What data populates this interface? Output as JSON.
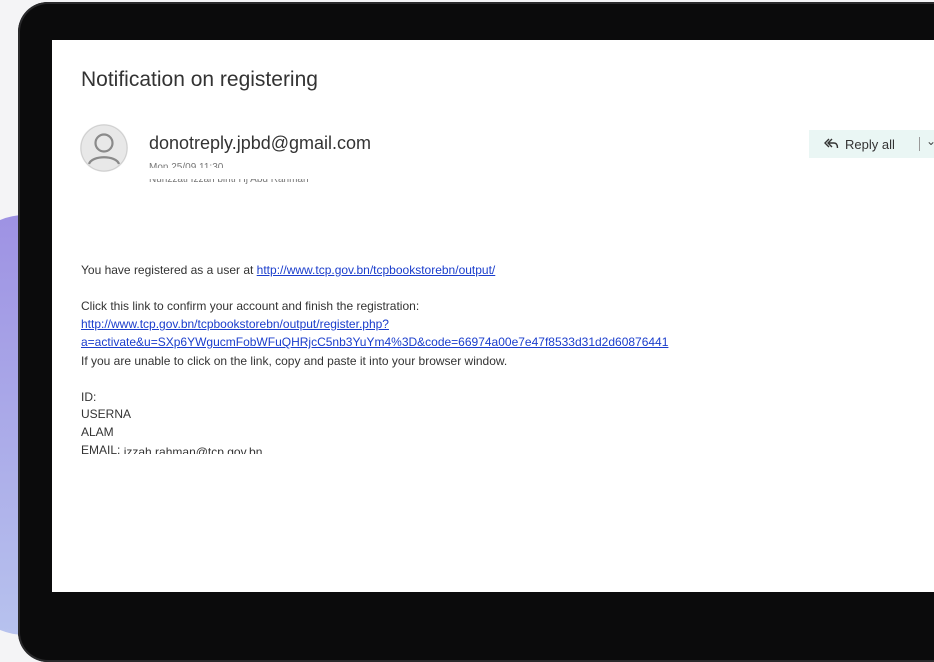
{
  "email": {
    "subject": "Notification on registering",
    "sender": "donotreply.jpbd@gmail.com",
    "date": "Mon 25/09 11:30",
    "to": "Nurizzati Izzah binti Hj Abd Rahman",
    "reply_all_label": "Reply all",
    "reply_menu_icon": "⌄"
  },
  "body": {
    "line1_prefix": "You have registered as a user at ",
    "line1_link": "http://www.tcp.gov.bn/tcpbookstorebn/output/",
    "confirm_text": "Click this link to confirm your account and finish the registration:",
    "confirm_link_1": "http://www.tcp.gov.bn/tcpbookstorebn/output/register.php?",
    "confirm_link_2": "a=activate&u=SXp6YWgucmFobWFuQHRjcC5nb3YuYm4%3D&code=66974a00e7e47f8533d31d2d60876441",
    "unable_text": "If you are unable to click on the link, copy and paste it into your browser window.",
    "id_label": "ID:",
    "username_label": "USERNA",
    "alamat_label": "ALAM",
    "email_label": "EMAIL:",
    "email_value": "izzah.rahman@tcp.gov.bn"
  }
}
